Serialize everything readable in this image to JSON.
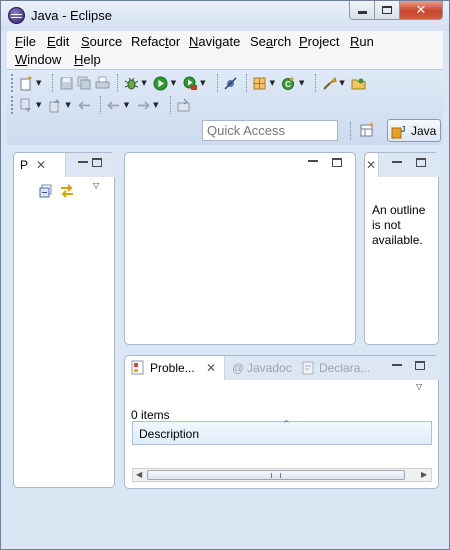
{
  "window": {
    "title": "Java - Eclipse",
    "min_glyph": "",
    "close_glyph": "✕"
  },
  "menu": {
    "items": [
      {
        "underline": "F",
        "rest": "ile"
      },
      {
        "underline": "E",
        "rest": "dit"
      },
      {
        "underline": "S",
        "rest": "ource"
      },
      {
        "pre": "Refac",
        "underline": "t",
        "rest": "or"
      },
      {
        "underline": "N",
        "rest": "avigate"
      },
      {
        "pre": "Se",
        "underline": "a",
        "rest": "rch"
      },
      {
        "underline": "P",
        "rest": "roject"
      },
      {
        "underline": "R",
        "rest": "un"
      },
      {
        "underline": "W",
        "rest": "indow"
      },
      {
        "underline": "H",
        "rest": "elp"
      }
    ]
  },
  "toolbar": {
    "quick_access_placeholder": "Quick Access",
    "perspective_label": "Java",
    "icons_row1": [
      "new-icon",
      "save-icon",
      "save-all-icon",
      "print-icon",
      "debug-icon",
      "run-icon",
      "run-external-icon",
      "toggle-breakpoint-icon",
      "new-java-project-icon",
      "new-class-icon",
      "open-type-icon",
      "open-folder-icon"
    ],
    "icons_row2": [
      "next-annotation-icon",
      "prev-annotation-icon",
      "last-edit-icon",
      "back-icon",
      "forward-icon",
      "pin-editor-icon"
    ]
  },
  "package_explorer": {
    "tab_label": "P",
    "close_glyph": "✕"
  },
  "outline": {
    "close_glyph": "✕",
    "message": "An outline is not available."
  },
  "bottom_panel": {
    "tabs": [
      {
        "label": "Proble...",
        "active": true
      },
      {
        "label": "Javadoc",
        "active": false
      },
      {
        "label": "Declara...",
        "active": false
      }
    ],
    "close_glyph": "✕",
    "at_glyph": "@",
    "items_count": "0 items",
    "columns": [
      "Description"
    ],
    "rows": []
  },
  "colors": {
    "chrome_bg": "#dbe6f4",
    "accent_green": "#2f9a2f",
    "accent_orange": "#e89a1a",
    "close_red": "#c8452c"
  }
}
